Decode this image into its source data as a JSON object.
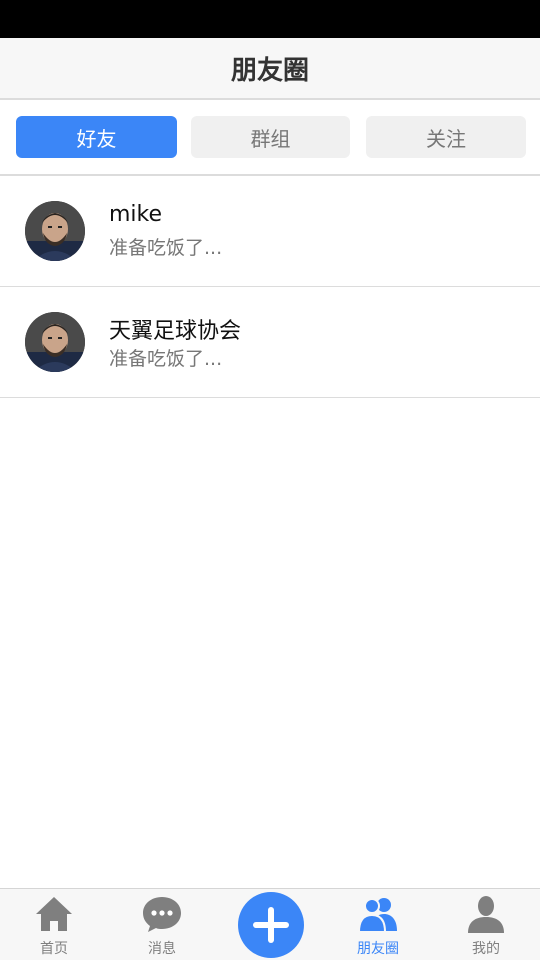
{
  "header": {
    "title": "朋友圈"
  },
  "segments": [
    {
      "label": "好友",
      "active": true
    },
    {
      "label": "群组",
      "active": false
    },
    {
      "label": "关注",
      "active": false
    }
  ],
  "feed": [
    {
      "name": "mike",
      "message": "准备吃饭了..."
    },
    {
      "name": "天翼足球协会",
      "message": "准备吃饭了..."
    }
  ],
  "tabbar": {
    "items": [
      {
        "label": "首页",
        "icon": "home-icon",
        "active": false
      },
      {
        "label": "消息",
        "icon": "chat-bubble-icon",
        "active": false
      },
      {
        "label": "朋友圈",
        "icon": "friends-icon",
        "active": true
      },
      {
        "label": "我的",
        "icon": "person-icon",
        "active": false
      }
    ],
    "center_icon": "plus-icon"
  },
  "colors": {
    "accent": "#3b86f7",
    "inactive": "#7f7f7f",
    "status_bar": "#000000"
  }
}
